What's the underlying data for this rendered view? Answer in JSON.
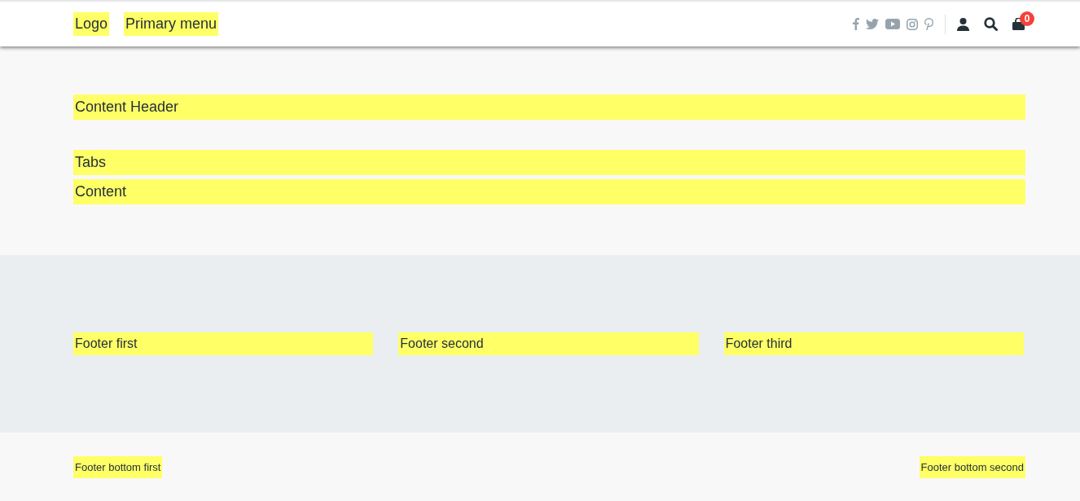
{
  "header": {
    "logo": "Logo",
    "primary_menu": "Primary menu",
    "cart_count": "0"
  },
  "main": {
    "content_header": "Content Header",
    "tabs": "Tabs",
    "content": "Content"
  },
  "footer": {
    "regions": [
      "Footer first",
      "Footer second",
      "Footer third"
    ]
  },
  "footer_bottom": {
    "first": "Footer bottom first",
    "second": "Footer bottom second"
  }
}
